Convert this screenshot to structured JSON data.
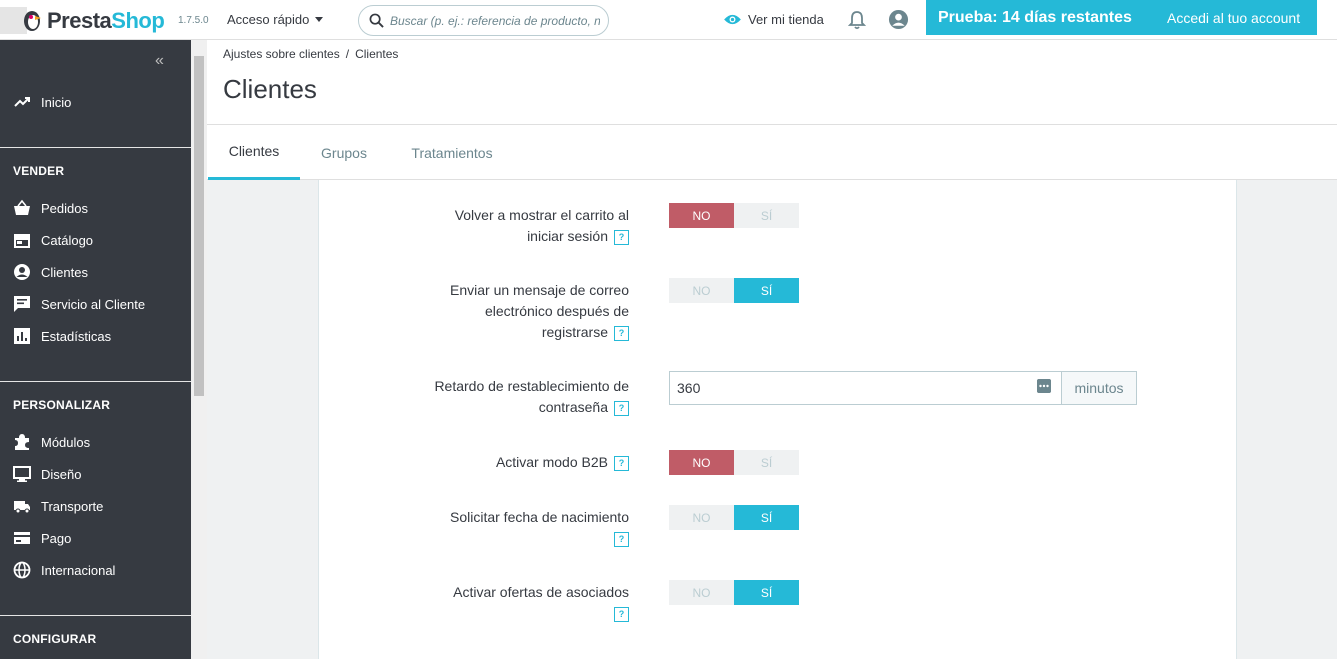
{
  "header": {
    "logo_presta": "Presta",
    "logo_shop": "Shop",
    "version": "1.7.5.0",
    "quick_access": "Acceso rápido",
    "search_placeholder": "Buscar (p. ej.: referencia de producto, nombre de cliente...)",
    "view_store": "Ver mi tienda",
    "trial_text": "Prueba: 14 días restantes",
    "account_link": "Accedi al tuo account"
  },
  "sidebar": {
    "collapse": "«",
    "home": "Inicio",
    "sections": [
      {
        "title": "VENDER",
        "items": [
          "Pedidos",
          "Catálogo",
          "Clientes",
          "Servicio al Cliente",
          "Estadísticas"
        ]
      },
      {
        "title": "PERSONALIZAR",
        "items": [
          "Módulos",
          "Diseño",
          "Transporte",
          "Pago",
          "Internacional"
        ]
      },
      {
        "title": "CONFIGURAR"
      }
    ]
  },
  "breadcrumb": [
    "Ajustes sobre clientes",
    "/",
    "Clientes"
  ],
  "page_title": "Clientes",
  "tabs": [
    "Clientes",
    "Grupos",
    "Tratamientos"
  ],
  "form": {
    "fields": [
      {
        "label_lines": [
          "Volver a mostrar el carrito al",
          "iniciar sesión"
        ],
        "value": "NO"
      },
      {
        "label_lines": [
          "Enviar un mensaje de correo",
          "electrónico después de",
          "registrarse"
        ],
        "value": "SÍ"
      },
      {
        "label_lines": [
          "Retardo de restablecimiento de",
          "contraseña"
        ],
        "input_value": "360",
        "unit": "minutos"
      },
      {
        "label_lines": [
          "Activar modo B2B"
        ],
        "value": "NO"
      },
      {
        "label_lines": [
          "Solicitar fecha de nacimiento"
        ],
        "value": "SÍ"
      },
      {
        "label_lines": [
          "Activar ofertas de asociados"
        ],
        "value": "SÍ"
      }
    ],
    "no_label": "NO",
    "si_label": "SÍ",
    "help_glyph": "?"
  },
  "colors": {
    "accent": "#25b9d7",
    "danger": "#c05c67",
    "sidebar": "#363a41"
  }
}
